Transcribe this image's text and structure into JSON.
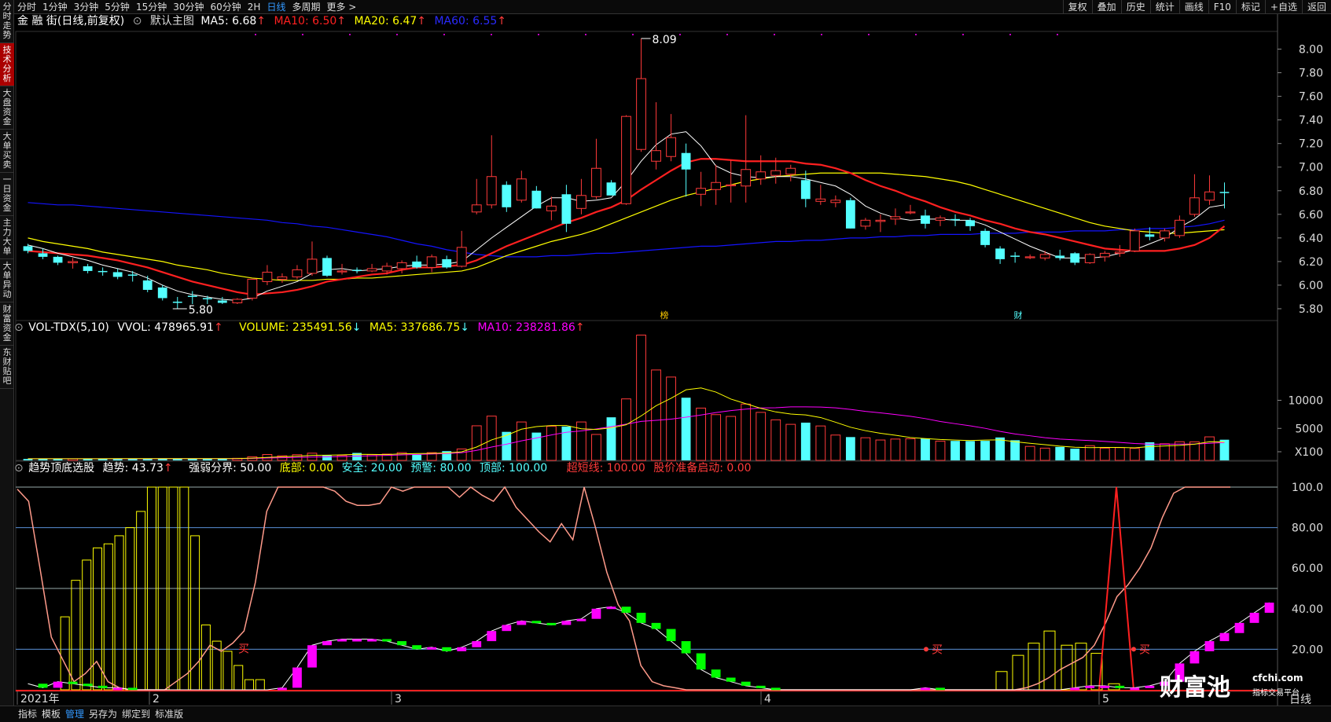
{
  "left_nav": [
    "分时走势",
    "技术分析",
    "大盘资金",
    "大单买卖",
    "一日资金",
    "主力大单",
    "大单异动",
    "财富资金",
    "东财贴吧"
  ],
  "left_active": 1,
  "top_tabs": [
    "分时",
    "1分钟",
    "3分钟",
    "5分钟",
    "15分钟",
    "30分钟",
    "60分钟",
    "2H",
    "日线",
    "多周期",
    "更多 >"
  ],
  "top_active": 8,
  "top_right": [
    "复权",
    "叠加",
    "历史",
    "统计",
    "画线",
    "F10",
    "标记",
    "+自选",
    "返回"
  ],
  "main_legend": {
    "title": "金 融 街(日线,前复权)",
    "template": "默认主图",
    "ma5": "MA5: 6.68",
    "ma10": "MA10: 6.50",
    "ma20": "MA20: 6.47",
    "ma60": "MA60: 6.55",
    "arrow": "↑"
  },
  "price_axis": [
    "8.00",
    "7.80",
    "7.60",
    "7.40",
    "7.20",
    "7.00",
    "6.80",
    "6.60",
    "6.40",
    "6.20",
    "6.00",
    "5.80"
  ],
  "price_high_label": "8.09",
  "price_low_label": "5.80",
  "event_labels": [
    "榜",
    "财"
  ],
  "vol_legend": {
    "name": "VOL-TDX(5,10)",
    "vvol": "VVOL: 478965.91",
    "volume": "VOLUME: 235491.56",
    "ma5": "MA5: 337686.75",
    "ma10": "MA10: 238281.86",
    "down": "↓",
    "up": "↑"
  },
  "vol_axis": [
    "10000",
    "5000",
    "X100"
  ],
  "ind_legend": {
    "name": "趋势顶底选股",
    "trend": "趋势: 43.73",
    "strength": "强弱分界: 50.00",
    "bottom": "底部: 0.00",
    "safe": "安全: 20.00",
    "warn": "预警: 80.00",
    "top": "顶部: 100.00",
    "super": "超短线: 100.00",
    "launch": "股价准备启动: 0.00",
    "arrow": "↑"
  },
  "ind_axis": [
    "100.0",
    "80.00",
    "60.00",
    "40.00",
    "20.00"
  ],
  "buy_label": "买",
  "date_labels": [
    "2021年",
    "2",
    "3",
    "4",
    "5"
  ],
  "period_label": "日线",
  "bottom_tabs": [
    "指标",
    "模板",
    "管理",
    "另存为",
    "绑定到",
    "标准版"
  ],
  "bottom_active": 2,
  "logo": {
    "name": "财富池",
    "site": "cfchi.com",
    "tagline": "指标交易平台"
  },
  "colors": {
    "up": "#ff3a3a",
    "down": "#54ffff",
    "ma5": "#ffffff",
    "ma10": "#ff2020",
    "ma20": "#ffff00",
    "ma60": "#1414ff",
    "vma5": "#ffff00",
    "vma10": "#ff00ff"
  },
  "chart_data": {
    "type": "candlestick",
    "ylim": [
      5.7,
      8.15
    ],
    "candles": [
      {
        "o": 6.33,
        "h": 6.35,
        "l": 6.27,
        "c": 6.29
      },
      {
        "o": 6.27,
        "h": 6.31,
        "l": 6.22,
        "c": 6.24
      },
      {
        "o": 6.24,
        "h": 6.25,
        "l": 6.17,
        "c": 6.19
      },
      {
        "o": 6.19,
        "h": 6.23,
        "l": 6.14,
        "c": 6.2
      },
      {
        "o": 6.16,
        "h": 6.18,
        "l": 6.1,
        "c": 6.12
      },
      {
        "o": 6.12,
        "h": 6.15,
        "l": 6.08,
        "c": 6.11
      },
      {
        "o": 6.11,
        "h": 6.14,
        "l": 6.05,
        "c": 6.07
      },
      {
        "o": 6.09,
        "h": 6.12,
        "l": 6.03,
        "c": 6.08
      },
      {
        "o": 6.04,
        "h": 6.08,
        "l": 5.94,
        "c": 5.96
      },
      {
        "o": 5.98,
        "h": 6.0,
        "l": 5.87,
        "c": 5.89
      },
      {
        "o": 5.86,
        "h": 5.9,
        "l": 5.8,
        "c": 5.85
      },
      {
        "o": 5.91,
        "h": 5.95,
        "l": 5.84,
        "c": 5.9
      },
      {
        "o": 5.89,
        "h": 5.91,
        "l": 5.84,
        "c": 5.88
      },
      {
        "o": 5.87,
        "h": 5.9,
        "l": 5.84,
        "c": 5.85
      },
      {
        "o": 5.85,
        "h": 5.89,
        "l": 5.84,
        "c": 5.88
      },
      {
        "o": 5.89,
        "h": 6.05,
        "l": 5.87,
        "c": 6.05
      },
      {
        "o": 6.03,
        "h": 6.17,
        "l": 6.0,
        "c": 6.11
      },
      {
        "o": 6.05,
        "h": 6.1,
        "l": 6.02,
        "c": 6.07
      },
      {
        "o": 6.07,
        "h": 6.17,
        "l": 6.05,
        "c": 6.13
      },
      {
        "o": 6.1,
        "h": 6.37,
        "l": 6.08,
        "c": 6.22
      },
      {
        "o": 6.23,
        "h": 6.25,
        "l": 6.07,
        "c": 6.08
      },
      {
        "o": 6.12,
        "h": 6.18,
        "l": 6.09,
        "c": 6.12
      },
      {
        "o": 6.13,
        "h": 6.15,
        "l": 6.1,
        "c": 6.12
      },
      {
        "o": 6.12,
        "h": 6.18,
        "l": 6.11,
        "c": 6.14
      },
      {
        "o": 6.12,
        "h": 6.19,
        "l": 6.09,
        "c": 6.16
      },
      {
        "o": 6.14,
        "h": 6.21,
        "l": 6.1,
        "c": 6.19
      },
      {
        "o": 6.2,
        "h": 6.25,
        "l": 6.14,
        "c": 6.15
      },
      {
        "o": 6.15,
        "h": 6.26,
        "l": 6.11,
        "c": 6.24
      },
      {
        "o": 6.22,
        "h": 6.25,
        "l": 6.14,
        "c": 6.15
      },
      {
        "o": 6.16,
        "h": 6.46,
        "l": 6.15,
        "c": 6.32
      },
      {
        "o": 6.62,
        "h": 6.9,
        "l": 6.6,
        "c": 6.68
      },
      {
        "o": 6.68,
        "h": 7.27,
        "l": 6.65,
        "c": 6.92
      },
      {
        "o": 6.85,
        "h": 6.88,
        "l": 6.62,
        "c": 6.66
      },
      {
        "o": 6.72,
        "h": 6.97,
        "l": 6.7,
        "c": 6.9
      },
      {
        "o": 6.8,
        "h": 6.84,
        "l": 6.65,
        "c": 6.65
      },
      {
        "o": 6.63,
        "h": 6.75,
        "l": 6.55,
        "c": 6.67
      },
      {
        "o": 6.77,
        "h": 6.85,
        "l": 6.45,
        "c": 6.52
      },
      {
        "o": 6.65,
        "h": 6.9,
        "l": 6.6,
        "c": 6.76
      },
      {
        "o": 6.75,
        "h": 7.24,
        "l": 6.73,
        "c": 6.99
      },
      {
        "o": 6.87,
        "h": 6.89,
        "l": 6.76,
        "c": 6.76
      },
      {
        "o": 6.69,
        "h": 7.44,
        "l": 6.68,
        "c": 7.43
      },
      {
        "o": 7.15,
        "h": 8.09,
        "l": 7.13,
        "c": 7.75
      },
      {
        "o": 7.05,
        "h": 7.55,
        "l": 6.98,
        "c": 7.14
      },
      {
        "o": 7.09,
        "h": 7.45,
        "l": 7.05,
        "c": 7.25
      },
      {
        "o": 7.12,
        "h": 7.2,
        "l": 6.75,
        "c": 6.98
      },
      {
        "o": 6.77,
        "h": 6.96,
        "l": 6.67,
        "c": 6.82
      },
      {
        "o": 6.81,
        "h": 7.02,
        "l": 6.68,
        "c": 6.87
      },
      {
        "o": 6.85,
        "h": 7.06,
        "l": 6.7,
        "c": 6.85
      },
      {
        "o": 6.84,
        "h": 7.44,
        "l": 6.7,
        "c": 6.98
      },
      {
        "o": 6.9,
        "h": 7.1,
        "l": 6.85,
        "c": 6.96
      },
      {
        "o": 6.93,
        "h": 7.08,
        "l": 6.86,
        "c": 6.97
      },
      {
        "o": 6.94,
        "h": 7.02,
        "l": 6.88,
        "c": 6.99
      },
      {
        "o": 6.89,
        "h": 6.97,
        "l": 6.66,
        "c": 6.73
      },
      {
        "o": 6.71,
        "h": 6.85,
        "l": 6.68,
        "c": 6.73
      },
      {
        "o": 6.7,
        "h": 6.76,
        "l": 6.66,
        "c": 6.72
      },
      {
        "o": 6.72,
        "h": 6.74,
        "l": 6.48,
        "c": 6.48
      },
      {
        "o": 6.5,
        "h": 6.57,
        "l": 6.47,
        "c": 6.55
      },
      {
        "o": 6.54,
        "h": 6.6,
        "l": 6.45,
        "c": 6.55
      },
      {
        "o": 6.56,
        "h": 6.65,
        "l": 6.51,
        "c": 6.58
      },
      {
        "o": 6.62,
        "h": 6.68,
        "l": 6.6,
        "c": 6.62
      },
      {
        "o": 6.59,
        "h": 6.64,
        "l": 6.48,
        "c": 6.52
      },
      {
        "o": 6.55,
        "h": 6.59,
        "l": 6.5,
        "c": 6.57
      },
      {
        "o": 6.56,
        "h": 6.6,
        "l": 6.5,
        "c": 6.55
      },
      {
        "o": 6.55,
        "h": 6.57,
        "l": 6.46,
        "c": 6.5
      },
      {
        "o": 6.46,
        "h": 6.48,
        "l": 6.32,
        "c": 6.34
      },
      {
        "o": 6.31,
        "h": 6.33,
        "l": 6.18,
        "c": 6.22
      },
      {
        "o": 6.25,
        "h": 6.28,
        "l": 6.19,
        "c": 6.24
      },
      {
        "o": 6.24,
        "h": 6.26,
        "l": 6.22,
        "c": 6.24
      },
      {
        "o": 6.23,
        "h": 6.29,
        "l": 6.21,
        "c": 6.26
      },
      {
        "o": 6.25,
        "h": 6.3,
        "l": 6.21,
        "c": 6.23
      },
      {
        "o": 6.27,
        "h": 6.28,
        "l": 6.17,
        "c": 6.19
      },
      {
        "o": 6.19,
        "h": 6.27,
        "l": 6.18,
        "c": 6.26
      },
      {
        "o": 6.24,
        "h": 6.29,
        "l": 6.2,
        "c": 6.27
      },
      {
        "o": 6.27,
        "h": 6.34,
        "l": 6.24,
        "c": 6.28
      },
      {
        "o": 6.29,
        "h": 6.48,
        "l": 6.28,
        "c": 6.46
      },
      {
        "o": 6.43,
        "h": 6.49,
        "l": 6.38,
        "c": 6.41
      },
      {
        "o": 6.4,
        "h": 6.48,
        "l": 6.37,
        "c": 6.46
      },
      {
        "o": 6.42,
        "h": 6.59,
        "l": 6.4,
        "c": 6.55
      },
      {
        "o": 6.6,
        "h": 6.94,
        "l": 6.58,
        "c": 6.74
      },
      {
        "o": 6.72,
        "h": 6.93,
        "l": 6.68,
        "c": 6.79
      },
      {
        "o": 6.79,
        "h": 6.87,
        "l": 6.65,
        "c": 6.78
      }
    ],
    "ma5": [
      6.34,
      6.31,
      6.27,
      6.24,
      6.21,
      6.17,
      6.14,
      6.11,
      6.06,
      6.0,
      5.95,
      5.92,
      5.9,
      5.88,
      5.87,
      5.89,
      5.95,
      5.99,
      6.03,
      6.1,
      6.13,
      6.14,
      6.12,
      6.13,
      6.14,
      6.16,
      6.17,
      6.17,
      6.18,
      6.2,
      6.3,
      6.4,
      6.49,
      6.58,
      6.67,
      6.74,
      6.74,
      6.71,
      6.72,
      6.74,
      6.88,
      7.05,
      7.19,
      7.28,
      7.3,
      7.18,
      7.01,
      6.95,
      6.92,
      6.91,
      6.92,
      6.92,
      6.9,
      6.87,
      6.84,
      6.77,
      6.67,
      6.61,
      6.57,
      6.55,
      6.56,
      6.56,
      6.55,
      6.55,
      6.51,
      6.45,
      6.39,
      6.33,
      6.28,
      6.23,
      6.23,
      6.23,
      6.24,
      6.27,
      6.3,
      6.35,
      6.4,
      6.49,
      6.56,
      6.66,
      6.68
    ],
    "ma10": [
      6.29,
      6.28,
      6.27,
      6.26,
      6.25,
      6.23,
      6.21,
      6.18,
      6.15,
      6.11,
      6.07,
      6.03,
      6.0,
      5.97,
      5.94,
      5.92,
      5.93,
      5.94,
      5.96,
      5.99,
      6.03,
      6.05,
      6.07,
      6.09,
      6.1,
      6.13,
      6.15,
      6.15,
      6.16,
      6.17,
      6.21,
      6.27,
      6.33,
      6.38,
      6.43,
      6.48,
      6.53,
      6.57,
      6.62,
      6.66,
      6.72,
      6.81,
      6.89,
      6.97,
      7.04,
      7.07,
      7.07,
      7.06,
      7.05,
      7.05,
      7.05,
      7.05,
      7.03,
      7.02,
      6.99,
      6.95,
      6.89,
      6.84,
      6.8,
      6.75,
      6.71,
      6.66,
      6.62,
      6.59,
      6.55,
      6.52,
      6.48,
      6.45,
      6.43,
      6.4,
      6.37,
      6.34,
      6.31,
      6.3,
      6.29,
      6.29,
      6.29,
      6.31,
      6.34,
      6.4,
      6.5
    ],
    "ma20": [
      6.4,
      6.37,
      6.35,
      6.33,
      6.31,
      6.28,
      6.26,
      6.24,
      6.22,
      6.2,
      6.17,
      6.15,
      6.13,
      6.1,
      6.08,
      6.06,
      6.05,
      6.04,
      6.04,
      6.04,
      6.05,
      6.05,
      6.06,
      6.06,
      6.07,
      6.08,
      6.09,
      6.1,
      6.11,
      6.12,
      6.15,
      6.2,
      6.25,
      6.29,
      6.33,
      6.37,
      6.4,
      6.43,
      6.47,
      6.52,
      6.57,
      6.62,
      6.67,
      6.72,
      6.76,
      6.79,
      6.82,
      6.85,
      6.88,
      6.9,
      6.92,
      6.93,
      6.94,
      6.95,
      6.95,
      6.95,
      6.95,
      6.95,
      6.94,
      6.93,
      6.92,
      6.9,
      6.88,
      6.85,
      6.81,
      6.77,
      6.73,
      6.69,
      6.65,
      6.61,
      6.57,
      6.53,
      6.5,
      6.48,
      6.46,
      6.45,
      6.44,
      6.44,
      6.45,
      6.46,
      6.47
    ],
    "ma60": [
      6.7,
      6.69,
      6.68,
      6.68,
      6.67,
      6.66,
      6.65,
      6.64,
      6.63,
      6.62,
      6.61,
      6.6,
      6.59,
      6.58,
      6.57,
      6.56,
      6.55,
      6.53,
      6.52,
      6.5,
      6.49,
      6.47,
      6.45,
      6.43,
      6.41,
      6.38,
      6.35,
      6.33,
      6.3,
      6.28,
      6.26,
      6.25,
      6.24,
      6.24,
      6.24,
      6.25,
      6.25,
      6.26,
      6.27,
      6.27,
      6.28,
      6.29,
      6.3,
      6.31,
      6.32,
      6.33,
      6.33,
      6.34,
      6.35,
      6.36,
      6.37,
      6.37,
      6.38,
      6.38,
      6.39,
      6.4,
      6.4,
      6.41,
      6.41,
      6.42,
      6.42,
      6.43,
      6.43,
      6.43,
      6.44,
      6.44,
      6.44,
      6.45,
      6.45,
      6.45,
      6.46,
      6.46,
      6.46,
      6.47,
      6.47,
      6.48,
      6.48,
      6.49,
      6.5,
      6.52,
      6.55
    ],
    "volume": [
      250,
      300,
      310,
      270,
      340,
      330,
      310,
      290,
      320,
      360,
      330,
      310,
      280,
      300,
      370,
      650,
      1050,
      820,
      1020,
      1280,
      880,
      880,
      1330,
      1020,
      1120,
      1380,
      1020,
      1380,
      1650,
      2030,
      6160,
      7880,
      5080,
      6840,
      4950,
      6070,
      6030,
      6840,
      4620,
      7670,
      10950,
      22310,
      16100,
      14840,
      11160,
      9310,
      8150,
      7830,
      10030,
      8550,
      7220,
      6420,
      6720,
      6130,
      4510,
      4150,
      4030,
      3630,
      3800,
      3850,
      3920,
      3420,
      3470,
      3440,
      3480,
      4080,
      3590,
      2490,
      2180,
      2400,
      2080,
      2620,
      2180,
      2270,
      2140,
      3230,
      2960,
      3320,
      3300,
      4190,
      3680
    ],
    "vma5": [
      290,
      290,
      290,
      290,
      290,
      300,
      310,
      310,
      320,
      320,
      320,
      320,
      320,
      320,
      330,
      410,
      530,
      650,
      750,
      900,
      920,
      980,
      1080,
      1070,
      1040,
      1160,
      1220,
      1250,
      1330,
      1520,
      2380,
      3650,
      4460,
      5560,
      6020,
      6200,
      6200,
      5630,
      5510,
      5780,
      6340,
      7920,
      9730,
      11060,
      12570,
      12900,
      12160,
      10920,
      10090,
      9270,
      8630,
      8250,
      8090,
      7630,
      6790,
      5900,
      5290,
      4820,
      4470,
      4080,
      3880,
      3720,
      3620,
      3530,
      3620,
      3650,
      3320,
      3040,
      2790,
      2530,
      2350,
      2280,
      2300,
      2300,
      2240,
      2470,
      2570,
      2680,
      2890,
      3320,
      3300
    ],
    "vma10": [
      300,
      300,
      300,
      300,
      300,
      300,
      300,
      300,
      300,
      310,
      310,
      310,
      310,
      310,
      320,
      350,
      420,
      480,
      540,
      600,
      630,
      680,
      760,
      830,
      890,
      980,
      1060,
      1140,
      1230,
      1370,
      1780,
      2380,
      2880,
      3480,
      3980,
      4530,
      5010,
      5250,
      5600,
      6000,
      6450,
      6940,
      7130,
      7340,
      7690,
      8080,
      8520,
      8870,
      9130,
      9330,
      9380,
      9530,
      9530,
      9500,
      9350,
      9080,
      8720,
      8460,
      8170,
      7850,
      7440,
      6930,
      6530,
      6150,
      5710,
      5160,
      4700,
      4380,
      4040,
      3790,
      3660,
      3540,
      3380,
      3200,
      3000,
      2890,
      2880,
      2910,
      2910,
      3040,
      3190
    ],
    "trend": [
      99,
      93,
      60,
      26,
      15,
      4,
      8,
      14,
      4,
      1,
      0,
      0,
      0,
      0,
      4,
      8,
      14,
      22,
      19,
      23,
      29,
      53,
      88,
      100,
      100,
      100,
      100,
      100,
      98,
      93,
      91,
      91,
      92,
      100,
      98,
      100,
      100,
      100,
      100,
      95,
      100,
      96,
      93,
      100,
      90,
      84,
      78,
      73,
      82,
      74,
      100,
      80,
      58,
      42,
      34,
      12,
      4,
      2,
      1,
      0,
      0,
      0,
      0,
      0,
      0,
      0,
      0,
      0,
      0,
      0,
      0,
      0,
      0,
      0,
      0,
      0,
      0,
      0,
      0,
      0,
      0,
      0,
      0,
      0,
      0,
      0,
      0,
      0,
      0,
      1,
      3,
      6,
      10,
      13,
      16,
      22,
      33,
      46,
      52,
      60,
      70,
      85,
      97,
      100,
      100,
      100,
      100,
      100
    ],
    "yellow_bars": [
      0,
      0,
      0,
      0,
      36,
      54,
      64,
      70,
      72,
      76,
      80,
      88,
      100,
      100,
      100,
      100,
      76,
      32,
      24,
      19,
      12,
      5,
      5,
      0,
      0,
      0,
      0,
      0,
      0,
      0,
      0,
      0,
      0,
      0,
      0,
      0,
      0,
      0,
      0,
      0,
      0,
      0,
      0,
      0,
      0,
      0,
      0,
      0,
      0,
      0,
      0,
      0,
      0,
      0,
      0,
      0,
      0,
      0,
      0,
      0,
      0,
      0,
      0,
      0,
      0,
      0,
      0,
      0,
      0,
      0,
      0,
      0,
      0,
      0,
      0,
      0,
      0,
      0,
      0,
      0,
      0,
      0,
      0,
      0,
      0,
      0,
      0,
      0,
      0,
      0,
      0,
      0,
      0,
      0,
      0,
      0,
      0,
      0,
      0,
      0,
      0,
      0,
      0,
      0,
      0,
      0,
      0,
      0,
      0,
      0,
      0,
      0,
      0,
      0,
      0
    ],
    "indicator": [
      3,
      1,
      4,
      3,
      2,
      1,
      1,
      0,
      0,
      0,
      0,
      0,
      0,
      0,
      0,
      0,
      0,
      1,
      11,
      22,
      24,
      25,
      25,
      25,
      24,
      22,
      20,
      21,
      19,
      21,
      24,
      29,
      32,
      34,
      33,
      32,
      34,
      35,
      40,
      41,
      38,
      33,
      30,
      24,
      18,
      10,
      6,
      4,
      2,
      1,
      0,
      0,
      0,
      0,
      0,
      0,
      0,
      0,
      0,
      0,
      1,
      0,
      0,
      0,
      0,
      0,
      0,
      0,
      0,
      0,
      1,
      2,
      2,
      1,
      1,
      2,
      4,
      13,
      19,
      24,
      28,
      33,
      38,
      43
    ]
  }
}
